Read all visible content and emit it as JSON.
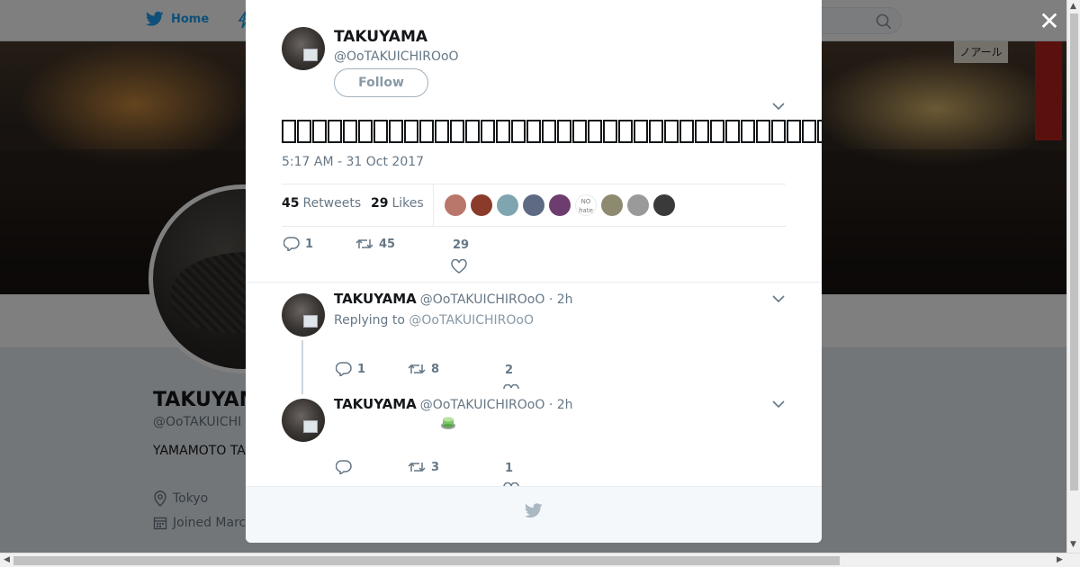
{
  "nav": {
    "home_label": "Home"
  },
  "profile": {
    "name": "TAKUYAM",
    "handle": "@OoTAKUICHI",
    "bio": "YAMAMOTO TA",
    "location": "Tokyo",
    "joined": "Joined Marc",
    "banner_signs": [
      "ノアール"
    ]
  },
  "tweet": {
    "author_name": "TAKUYAMA",
    "author_handle": "@OoTAKUICHIROoO",
    "follow_label": "Follow",
    "timestamp": "5:17 AM - 31 Oct 2017",
    "retweets_count": "45",
    "retweets_label": "Retweets",
    "likes_count": "29",
    "likes_label": "Likes",
    "liker_colors": [
      "#b9776b",
      "#8a3b2a",
      "#7fa6b0",
      "#5e6a83",
      "#6e3d70",
      "#ffffff",
      "#8e8a70",
      "#9a9a9a",
      "#3a3a3a"
    ],
    "liker_no_hate_text": "NO hate",
    "reply_count": "1",
    "retweet_count": "45",
    "like_count": "29"
  },
  "replies": [
    {
      "author_name": "TAKUYAMA",
      "author_handle": "@OoTAKUICHIROoO · 2h",
      "replying_prefix": "Replying to",
      "replying_to": "@OoTAKUICHIROoO",
      "reply_count": "1",
      "retweet_count": "8",
      "like_count": "2"
    },
    {
      "author_name": "TAKUYAMA",
      "author_handle": "@OoTAKUICHIROoO · 2h",
      "reply_count": "",
      "retweet_count": "3",
      "like_count": "1"
    }
  ],
  "colors": {
    "brand": "#1da1f2",
    "muted": "#657786",
    "text": "#14171a"
  }
}
